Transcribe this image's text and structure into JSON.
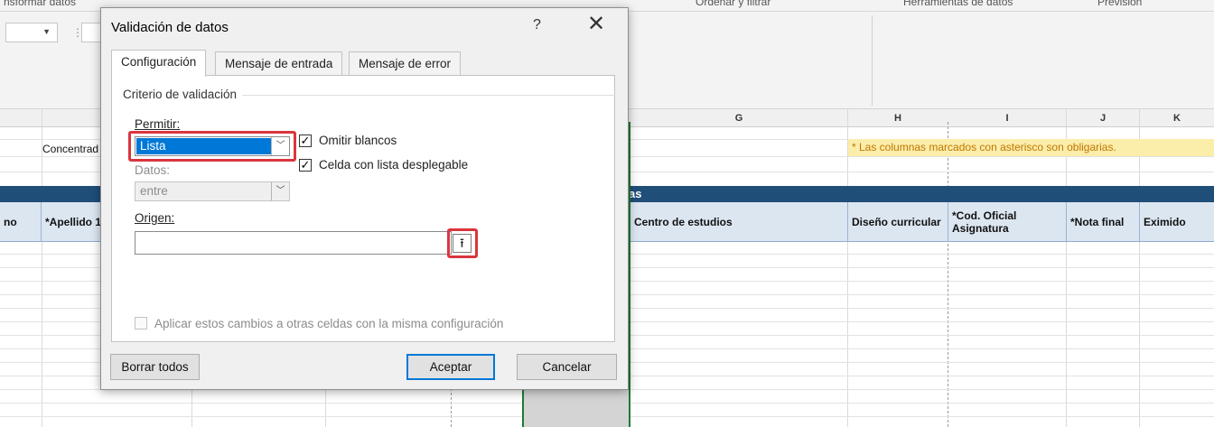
{
  "ribbon": {
    "top_labels": [
      "nsformar datos",
      "Ordenar y filtrar",
      "Herramientas de datos",
      "Previsión"
    ]
  },
  "sheet": {
    "columns": [
      "G",
      "H",
      "I",
      "J",
      "K"
    ],
    "title_band_text": "as",
    "headers": [
      "no",
      "*Apellido 1",
      "Centro de estudios",
      "Diseño curricular",
      "*Cod. Oficial Asignatura",
      "*Nota final",
      "Eximido"
    ],
    "concentrad": "Concentrad",
    "note": "* Las columnas marcados con asterisco son obligarias."
  },
  "dialog": {
    "title": "Validación de datos",
    "help": "?",
    "close": "✕",
    "tabs": [
      "Configuración",
      "Mensaje de entrada",
      "Mensaje de error"
    ],
    "criteria_legend": "Criterio de validación",
    "allow_label": "Permitir:",
    "allow_value": "Lista",
    "data_label": "Datos:",
    "data_value": "entre",
    "ignore_blank": {
      "label": "Omitir blancos",
      "checked": true
    },
    "in_cell_dropdown": {
      "label": "Celda con lista desplegable",
      "checked": true
    },
    "source_label": "Origen:",
    "source_value": "",
    "apply_all": {
      "label": "Aplicar estos cambios a otras celdas con la misma configuración",
      "checked": false
    },
    "buttons": {
      "clear_all": "Borrar todos",
      "ok": "Aceptar",
      "cancel": "Cancelar"
    }
  },
  "colors": {
    "highlight": "#d9363e",
    "selection": "#0078d7",
    "title_band": "#1f4e79",
    "header_fill": "#dce6f1",
    "note_fill": "#fbedaa",
    "selected_column_border": "#1e7b34"
  }
}
